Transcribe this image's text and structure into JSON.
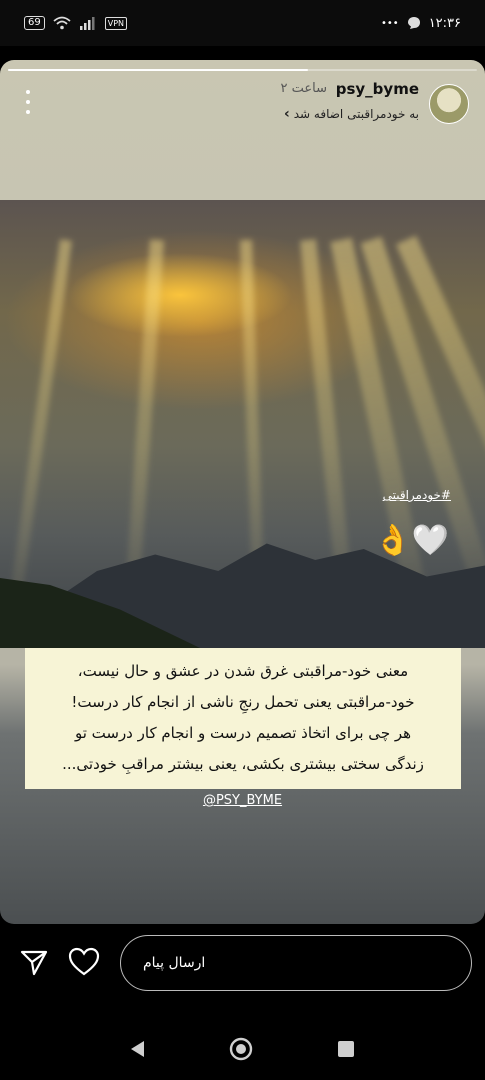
{
  "status_bar": {
    "battery": "69",
    "vpn": "VPN",
    "time": "۱۲:۳۶",
    "dots": "•••"
  },
  "story": {
    "username": "psy_byme",
    "time_ago": "۲ ساعت",
    "added_to": "به خودمراقبتی اضافه شد",
    "hashtag": "#خودمراقبتی",
    "stickers": "👌🤍",
    "caption_lines": [
      "معنی خود-مراقبتی غرق شدن در عشق و حال نیست،",
      "خود-مراقبتی یعنی تحمل رنجِ ناشی از انجام کار درست!",
      "هر چی برای اتخاذ تصمیم درست و انجام کار درست تو",
      "زندگی سختی بیشتری بکشی، یعنی بیشتر مراقبِ خودتی..."
    ],
    "handle": "@PSY_BYME",
    "progress": 0.64
  },
  "reply": {
    "placeholder": "ارسال پیام"
  }
}
